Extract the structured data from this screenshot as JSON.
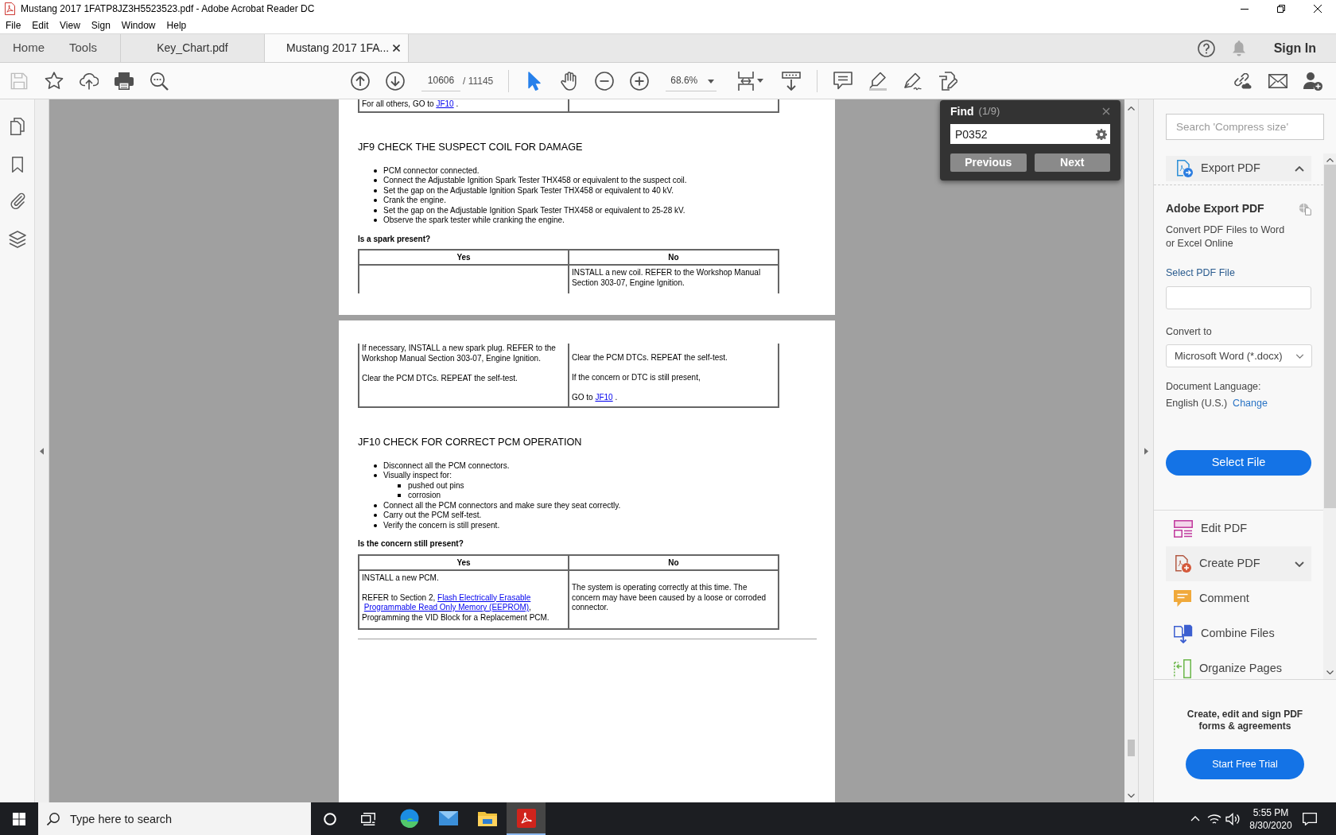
{
  "window": {
    "title": "Mustang 2017 1FATP8JZ3H5523523.pdf - Adobe Acrobat Reader DC"
  },
  "menu_bar": [
    "File",
    "Edit",
    "View",
    "Sign",
    "Window",
    "Help"
  ],
  "tab_bar": {
    "nav": [
      {
        "label": "Home",
        "selected": false
      },
      {
        "label": "Tools",
        "selected": false
      }
    ],
    "documents": [
      {
        "label": "Key_Chart.pdf",
        "selected": false
      },
      {
        "label": "Mustang 2017 1FA...",
        "selected": true
      }
    ],
    "sign_in": "Sign In"
  },
  "toolbar": {
    "save": {
      "disabled": true
    },
    "page_number": "10606",
    "page_count": "/ 11145",
    "select_tool": {
      "selected": true
    },
    "hand_tool": {
      "selected": false
    },
    "zoom": "68.6%"
  },
  "document": {
    "pages": [
      {
        "blocks": [
          {
            "kind": "table",
            "open_top": true,
            "open_bottom": false,
            "rows": [
              [
                {
                  "paragraphs": [
                    [
                      {
                        "kind": "text",
                        "text": "For all others, GO to "
                      },
                      {
                        "kind": "link",
                        "text": "JF10"
                      },
                      {
                        "kind": "text",
                        "text": " ."
                      }
                    ]
                  ]
                },
                {}
              ]
            ]
          },
          {
            "kind": "heading",
            "text": "JF9 CHECK THE SUSPECT COIL FOR DAMAGE"
          },
          {
            "kind": "bullets",
            "items": [
              {
                "text": "PCM connector connected."
              },
              {
                "text": "Connect the Adjustable Ignition Spark Tester THX458 or equivalent to the suspect coil."
              },
              {
                "text": "Set the gap on the Adjustable Ignition Spark Tester THX458 or equivalent to 40 kV."
              },
              {
                "text": "Crank the engine."
              },
              {
                "text": "Set the gap on the Adjustable Ignition Spark Tester THX458 or equivalent to 25-28 kV."
              },
              {
                "text": "Observe the spark tester while cranking the engine."
              }
            ]
          },
          {
            "kind": "question",
            "text": "Is a spark present?"
          },
          {
            "kind": "table",
            "open_top": false,
            "open_bottom": true,
            "columns": [
              "Yes",
              "No"
            ],
            "rows": [
              [
                {},
                {
                  "paragraphs": [
                    "INSTALL a new coil. REFER to the Workshop Manual Section 303-07, Engine Ignition."
                  ]
                }
              ]
            ]
          }
        ]
      },
      {
        "blocks": [
          {
            "kind": "table",
            "open_top": true,
            "open_bottom": false,
            "rows": [
              [
                {
                  "paragraphs": [
                    "If necessary, INSTALL a new spark plug. REFER to the Workshop Manual Section 303-07, Engine Ignition.",
                    "Clear the PCM DTCs. REPEAT the self-test."
                  ]
                },
                {
                  "paragraphs": [
                    "Clear the PCM DTCs. REPEAT the self-test.",
                    "If the concern or DTC is still present,",
                    [
                      {
                        "kind": "text",
                        "text": "GO to "
                      },
                      {
                        "kind": "link",
                        "text": "JF10"
                      },
                      {
                        "kind": "text",
                        "text": " ."
                      }
                    ]
                  ]
                }
              ]
            ]
          },
          {
            "kind": "heading",
            "text": "JF10 CHECK FOR CORRECT PCM OPERATION"
          },
          {
            "kind": "bullets",
            "items": [
              {
                "text": "Disconnect all the PCM connectors."
              },
              {
                "text": "Visually inspect for:",
                "children": [
                  {
                    "text": "pushed out pins"
                  },
                  {
                    "text": "corrosion"
                  }
                ]
              },
              {
                "text": "Connect all the PCM connectors and make sure they seat correctly."
              },
              {
                "text": "Carry out the PCM self-test."
              },
              {
                "text": "Verify the concern is still present."
              }
            ]
          },
          {
            "kind": "question",
            "text": "Is the concern still present?"
          },
          {
            "kind": "table",
            "open_top": false,
            "open_bottom": false,
            "columns": [
              "Yes",
              "No"
            ],
            "rows": [
              [
                {
                  "paragraphs": [
                    "INSTALL a new PCM.",
                    [
                      {
                        "kind": "text",
                        "text": "REFER to Section 2, "
                      },
                      {
                        "kind": "link",
                        "text": "Flash Electrically Erasable"
                      },
                      {
                        "kind": "link",
                        "text": "Programmable Read Only Memory (EEPROM)"
                      },
                      {
                        "kind": "text",
                        "text": ", Programming the VID Block for a Replacement PCM."
                      }
                    ]
                  ]
                },
                {
                  "paragraphs": [
                    "The system is operating correctly at this time. The concern may have been caused by a loose or corroded connector."
                  ]
                }
              ]
            ]
          },
          {
            "kind": "rule"
          }
        ]
      }
    ]
  },
  "find": {
    "title": "Find",
    "count": "(1/9)",
    "query": "P0352",
    "buttons": [
      "Previous",
      "Next"
    ]
  },
  "tools_pane": {
    "search": {
      "placeholder": "Search 'Compress size'"
    },
    "export": {
      "label": "Export PDF",
      "expanded": true,
      "title": "Adobe Export PDF",
      "description": "Convert PDF Files to Word or Excel Online",
      "file_label": "Select PDF File",
      "convert_label": "Convert to",
      "format": "Microsoft Word (*.docx)",
      "language_label": "Document Language:",
      "language": "English (U.S.)",
      "change": "Change",
      "button": "Select File"
    },
    "tools": [
      {
        "label": "Edit PDF"
      },
      {
        "label": "Create PDF",
        "expanded": false
      },
      {
        "label": "Comment"
      },
      {
        "label": "Combine Files"
      },
      {
        "label": "Organize Pages"
      }
    ],
    "promo": {
      "text": "Create, edit and sign PDF forms & agreements",
      "button": "Start Free Trial"
    }
  },
  "taskbar": {
    "search": {
      "placeholder": "Type here to search"
    },
    "apps": [
      {
        "selected": false
      },
      {
        "selected": false
      },
      {
        "selected": false
      },
      {
        "selected": true
      }
    ],
    "clock": {
      "time": "5:55 PM",
      "date": "8/30/2020"
    }
  }
}
